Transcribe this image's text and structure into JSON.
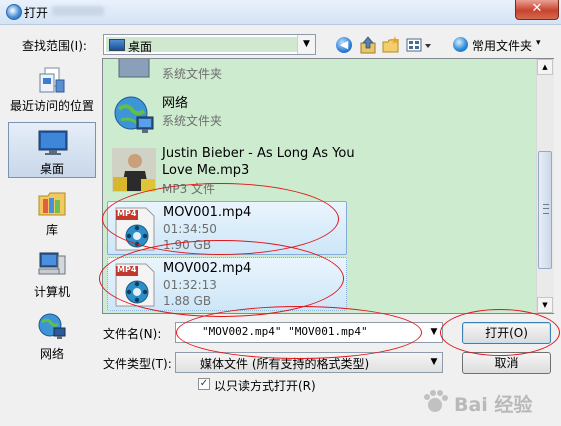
{
  "window": {
    "title": "打开",
    "close_glyph": "✕"
  },
  "toolbar": {
    "look_in_label": "查找范围(I):",
    "look_in_value": "桌面",
    "dropdown_glyph": "▼",
    "back_glyph": "◀",
    "up_glyph": "↑",
    "new_folder_glyph": "✱",
    "views_glyph": "▤▾",
    "common_folders_label": "常用文件夹",
    "common_folders_arrow": "▾"
  },
  "places_bar": [
    {
      "label": "最近访问的位置",
      "icon": "recent-places-icon"
    },
    {
      "label": "桌面",
      "icon": "desktop-icon"
    },
    {
      "label": "库",
      "icon": "library-icon"
    },
    {
      "label": "计算机",
      "icon": "computer-icon"
    },
    {
      "label": "网络",
      "icon": "network-icon"
    }
  ],
  "file_list": {
    "items": [
      {
        "name": "",
        "sub1": "系统文件夹",
        "icon": "folder-icon"
      },
      {
        "name": "网络",
        "sub1": "系统文件夹",
        "icon": "network-globe-icon"
      },
      {
        "name": "Justin Bieber - As Long As You",
        "name2": "Love Me.mp3",
        "sub1": "MP3 文件",
        "icon": "album-art-icon"
      },
      {
        "name": "MOV001.mp4",
        "sub1": "01:34:50",
        "sub2": "1.90 GB",
        "icon": "mp4-file-icon",
        "badge": "MP4"
      },
      {
        "name": "MOV002.mp4",
        "sub1": "01:32:13",
        "sub2": "1.88 GB",
        "icon": "mp4-file-icon",
        "badge": "MP4"
      }
    ]
  },
  "scrollbar": {
    "up": "▲",
    "down": "▼"
  },
  "bottom": {
    "file_name_label": "文件名(N):",
    "file_name_value": "\"MOV002.mp4\" \"MOV001.mp4\"",
    "file_type_label": "文件类型(T):",
    "file_type_value": "媒体文件 (所有支持的格式类型)",
    "open_button": "打开(O)",
    "cancel_button": "取消",
    "read_only_label": "以只读方式打开(R)",
    "read_only_checked": "✓",
    "dropdown_glyph": "▼"
  },
  "watermark": {
    "text": "Bai 经验"
  },
  "colors": {
    "list_bg": "#cdebcf",
    "selection": "#cde6f8",
    "annotation": "#e0161b"
  }
}
